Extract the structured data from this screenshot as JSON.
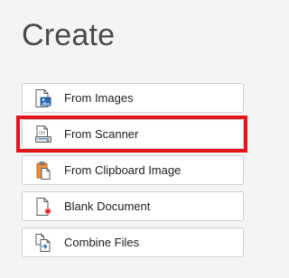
{
  "title": "Create",
  "items": [
    {
      "label": "From Images",
      "icon": "image-file-icon"
    },
    {
      "label": "From Scanner",
      "icon": "scanner-icon",
      "highlighted": true
    },
    {
      "label": "From Clipboard Image",
      "icon": "clipboard-icon"
    },
    {
      "label": "Blank Document",
      "icon": "blank-document-icon"
    },
    {
      "label": "Combine Files",
      "icon": "combine-files-icon"
    }
  ],
  "colors": {
    "highlight": "#e3141c",
    "accent_blue": "#2b6cb0",
    "accent_red": "#e3141c",
    "clipboard_orange": "#e8913a"
  }
}
